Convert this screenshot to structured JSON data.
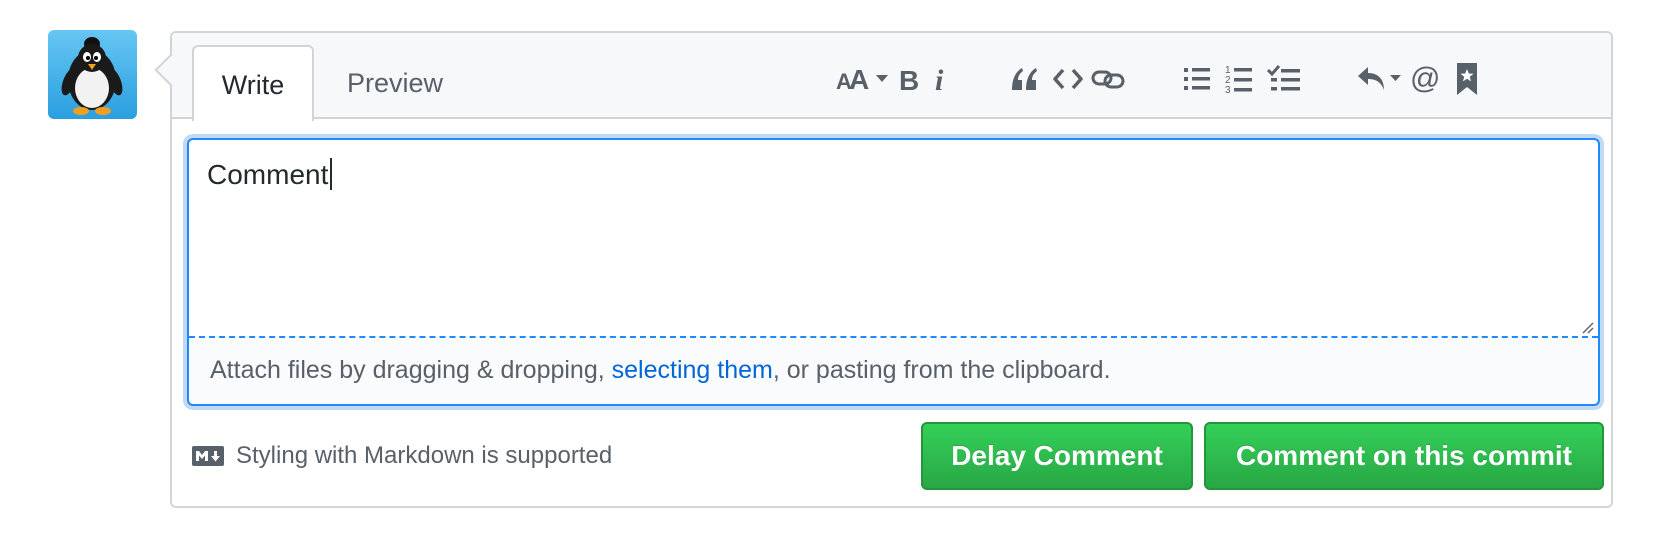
{
  "tabs": {
    "write": "Write",
    "preview": "Preview"
  },
  "toolbar": {
    "heading": "header-icon",
    "bold": "bold-icon",
    "italic": "italic-icon",
    "quote": "quote-icon",
    "code": "code-icon",
    "link": "link-icon",
    "bullet_list": "bullet-list-icon",
    "numbered_list": "numbered-list-icon",
    "task_list": "task-list-icon",
    "reply": "reply-icon",
    "mention": "mention-icon",
    "reference": "bookmark-icon"
  },
  "editor": {
    "value": "Comment",
    "attach_prefix": "Attach files by dragging & dropping, ",
    "attach_link": "selecting them",
    "attach_suffix": ", or pasting from the clipboard."
  },
  "footer": {
    "markdown_hint": "Styling with Markdown is supported",
    "delay_button": "Delay Comment",
    "commit_button": "Comment on this commit"
  },
  "colors": {
    "accent_blue": "#2188ff",
    "link_blue": "#0366d6",
    "button_green": "#28a745"
  }
}
